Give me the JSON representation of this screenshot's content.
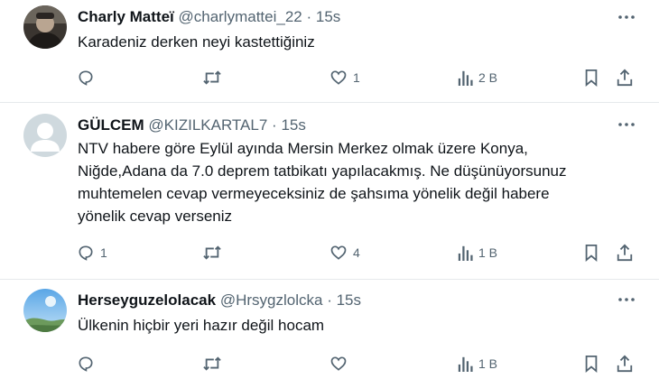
{
  "tweets": [
    {
      "name": "Charly Matteï",
      "handle": "@charlymattei_22",
      "dot": "·",
      "time": "15s",
      "text_lines": [
        "Karadeniz derken neyi kastettiğiniz"
      ],
      "replies": "",
      "retweets": "",
      "likes": "1",
      "views": "2 B",
      "avatar": "dark-person-photo"
    },
    {
      "name": "GÜLCEM",
      "handle": "@KIZILKARTAL7",
      "dot": "·",
      "time": "15s",
      "text_lines": [
        "NTV habere göre Eylül ayında Mersin Merkez olmak üzere Konya,",
        "Niğde,Adana da 7.0  deprem tatbikatı yapılacakmış. Ne düşünüyorsunuz",
        "muhtemelen cevap vermeyeceksiniz de şahsıma yönelik değil habere",
        "yönelik cevap verseniz"
      ],
      "replies": "1",
      "retweets": "",
      "likes": "4",
      "views": "1 B",
      "avatar": "default-person-placeholder"
    },
    {
      "name": "Herseyguzelolacak",
      "handle": "@Hrsygzlolcka",
      "dot": "·",
      "time": "15s",
      "text_lines": [
        "Ülkenin hiçbir yeri hazır değil hocam"
      ],
      "replies": "",
      "retweets": "",
      "likes": "",
      "views": "1 B",
      "avatar": "sky-landscape-photo"
    }
  ],
  "icons": [
    "more-icon",
    "reply-icon",
    "retweet-icon",
    "like-icon",
    "views-icon",
    "bookmark-icon",
    "share-icon"
  ],
  "colors": {
    "text": "#0f1419",
    "secondary": "#536471",
    "divider": "#e6e9eb"
  }
}
